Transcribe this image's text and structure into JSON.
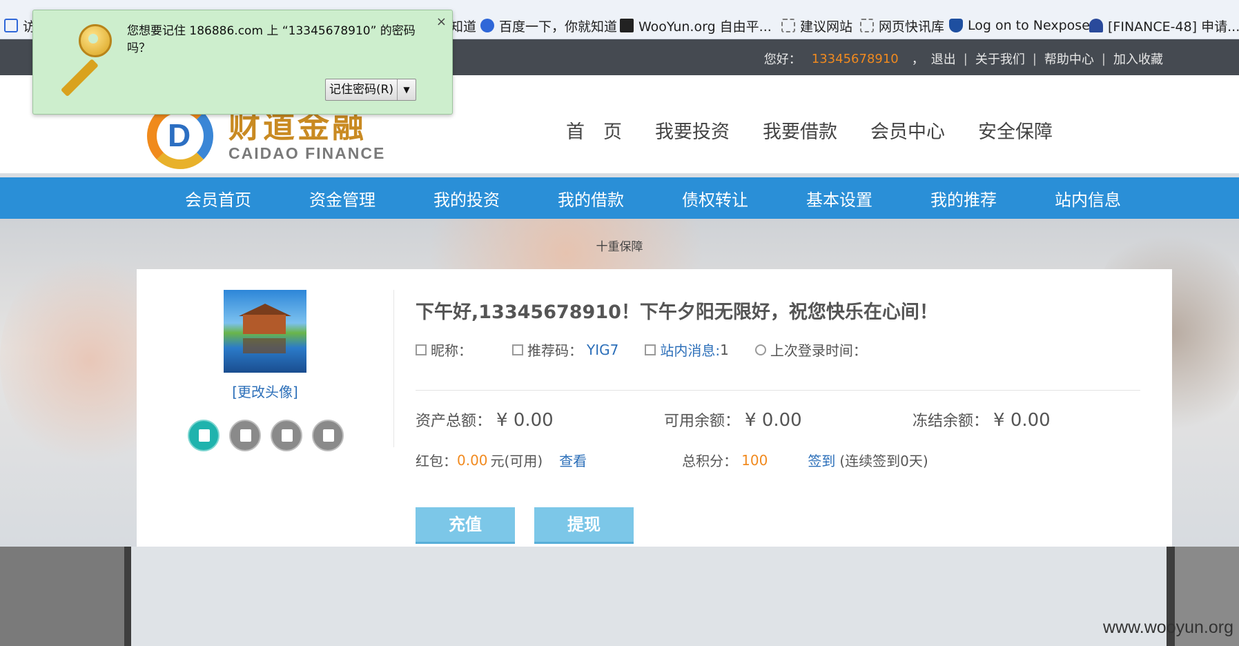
{
  "browser": {
    "bookmarks": [
      {
        "label": "访",
        "icon": "search-icon"
      },
      {
        "label": "知道",
        "icon": "page-icon"
      },
      {
        "label": "百度一下，你就知道",
        "icon": "baidu-paw-icon"
      },
      {
        "label": "WooYun.org  自由平...",
        "icon": "wooyun-icon"
      },
      {
        "label": "建议网站",
        "icon": "dashed-page-icon"
      },
      {
        "label": "网页快讯库",
        "icon": "dashed-page-icon"
      },
      {
        "label": "Log on to Nexpose",
        "icon": "shield-icon"
      },
      {
        "label": "[FINANCE-48] 申请...",
        "icon": "person-icon"
      }
    ]
  },
  "password_popup": {
    "message": "您想要记住 186886.com 上 “13345678910” 的密码吗？",
    "save_label": "记住密码(R)",
    "close_label": "×",
    "dropdown_label": "▼"
  },
  "topbar": {
    "greeting": "您好：",
    "phone": "13345678910",
    "comma": "，",
    "links": [
      "退出",
      "关于我们",
      "帮助中心",
      "加入收藏"
    ],
    "separator": "|"
  },
  "logo": {
    "letter": "D",
    "cn": "财道金融",
    "en": "CAIDAO FINANCE"
  },
  "main_nav": [
    "首　页",
    "我要投资",
    "我要借款",
    "会员中心",
    "安全保障"
  ],
  "sub_nav": [
    "会员首页",
    "资金管理",
    "我的投资",
    "我的借款",
    "债权转让",
    "基本设置",
    "我的推荐",
    "站内信息"
  ],
  "hero": {
    "tagline": "十重保障"
  },
  "profile": {
    "change_avatar": "[更改头像]",
    "greeting": "下午好,13345678910！下午夕阳无限好，祝您快乐在心间！",
    "nickname_label": "昵称：",
    "referral_label": "推荐码：",
    "referral_code": "YIG7",
    "messages_label": "站内消息:",
    "messages_count": "1",
    "last_login_label": "上次登录时间：",
    "total_assets_label": "资产总额：",
    "total_assets": "¥  0.00",
    "available_label": "可用余额：",
    "available": "¥  0.00",
    "frozen_label": "冻结余额：",
    "frozen": "¥ 0.00",
    "redpacket_label": "红包：",
    "redpacket_value": "0.00",
    "redpacket_unit": "元(可用)",
    "view_label": "查看",
    "points_label": "总积分：",
    "points_value": "100",
    "checkin_label": "签到",
    "checkin_streak": "(连续签到0天)",
    "recharge_label": "充值",
    "withdraw_label": "提现"
  },
  "watermark": "www.wooyun.org"
}
